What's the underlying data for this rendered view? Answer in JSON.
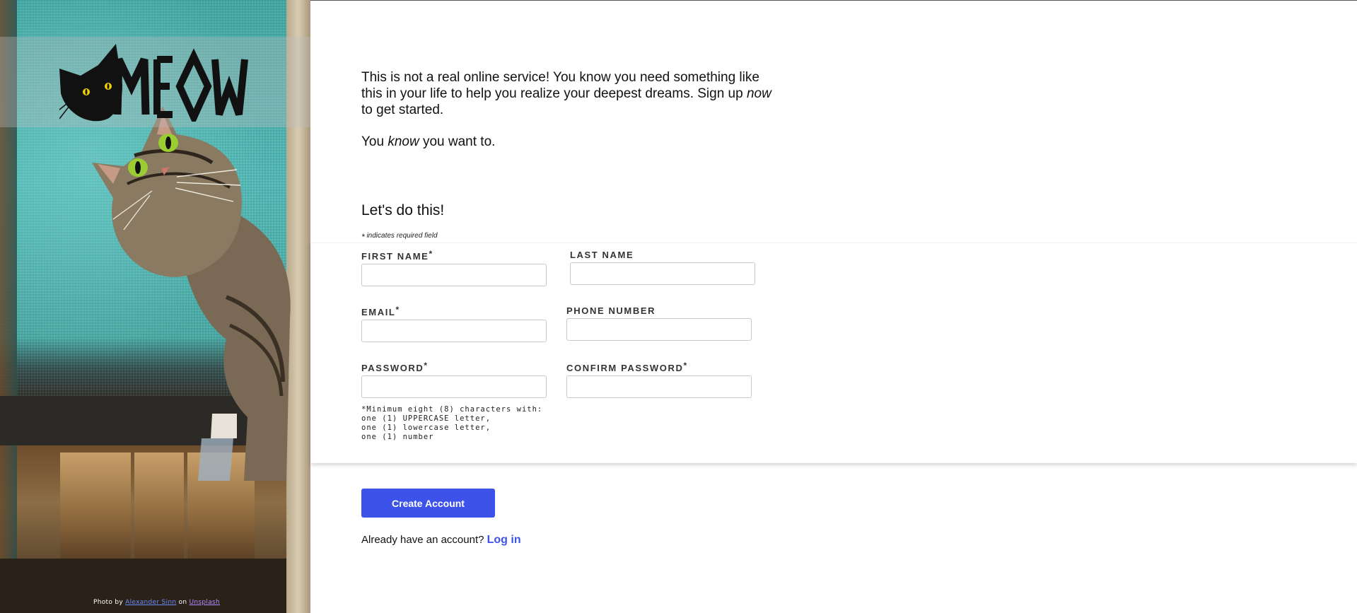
{
  "branding": {
    "logo_text": "MEOW",
    "photo_credit": {
      "prefix": "Photo by",
      "author": "Alexander Sinn",
      "on": "on",
      "source": "Unsplash"
    }
  },
  "intro": {
    "line1_part1": "This is not a real online service! You know you need something like this in your life to help you realize your deepest dreams. Sign up ",
    "line1_em": "now",
    "line1_part2": " to get started.",
    "line2_part1": "You ",
    "line2_em": "know",
    "line2_part2": " you want to."
  },
  "form": {
    "heading": "Let's do this!",
    "required_marker": "*",
    "required_note": "indicates required field",
    "fields": {
      "first_name": {
        "label": "FIRST NAME",
        "required": "*",
        "value": ""
      },
      "last_name": {
        "label": "LAST NAME",
        "required": "",
        "value": ""
      },
      "email": {
        "label": "EMAIL",
        "required": "*",
        "value": ""
      },
      "phone": {
        "label": "PHONE NUMBER",
        "required": "",
        "value": ""
      },
      "password": {
        "label": "PASSWORD",
        "required": "*",
        "value": ""
      },
      "confirm_password": {
        "label": "CONFIRM PASSWORD",
        "required": "*",
        "value": ""
      }
    },
    "password_hint": [
      "*Minimum eight (8) characters with:",
      "one (1) UPPERCASE letter,",
      "one (1) lowercase letter,",
      "one (1) number"
    ],
    "submit_label": "Create Account",
    "login_prompt": "Already have an account?",
    "login_link": "Log in"
  },
  "colors": {
    "accent": "#3d52e8",
    "panel_teal": "#4fb8b5"
  }
}
